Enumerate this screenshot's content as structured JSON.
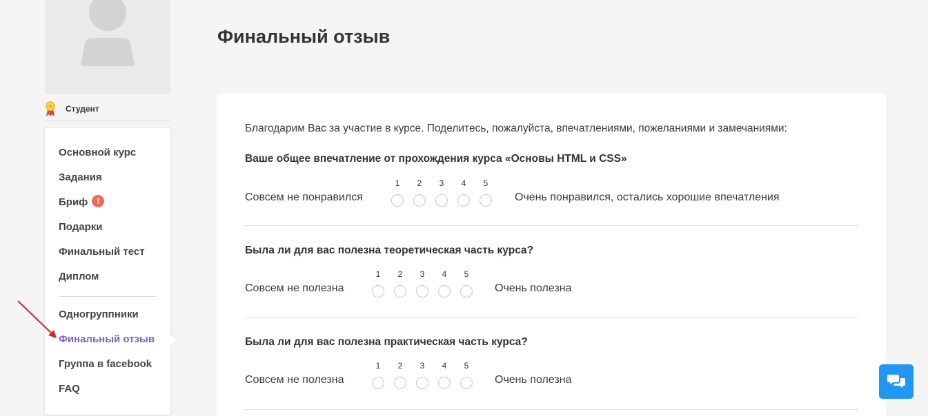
{
  "profile": {
    "role_label": "Студент"
  },
  "sidebar": {
    "items": [
      {
        "label": "Основной курс"
      },
      {
        "label": "Задания"
      },
      {
        "label": "Бриф",
        "badge": "!"
      },
      {
        "label": "Подарки"
      },
      {
        "label": "Финальный тест"
      },
      {
        "label": "Диплом"
      },
      {
        "label": "Одногруппники"
      },
      {
        "label": "Финальный отзыв",
        "active": true
      },
      {
        "label": "Группа в facebook"
      },
      {
        "label": "FAQ"
      }
    ]
  },
  "main": {
    "title": "Финальный отзыв",
    "intro": "Благодарим Вас за участие в курсе. Поделитесь, пожалуйста, впечатлениями, пожеланиями и замечаниями:",
    "scale_numbers": [
      "1",
      "2",
      "3",
      "4",
      "5"
    ],
    "questions": [
      {
        "title": "Ваше общее впечатление от прохождения курса «Основы HTML и CSS»",
        "low": "Совсем не понравился",
        "high": "Очень понравился, остались хорошие впечатления"
      },
      {
        "title": "Была ли для вас полезна теоретическая часть курса?",
        "low": "Совсем не полезна",
        "high": "Очень полезна"
      },
      {
        "title": "Была ли для вас полезна практическая часть курса?",
        "low": "Совсем не полезна",
        "high": "Очень полезна"
      }
    ]
  },
  "colors": {
    "accent": "#7b5fc7",
    "badge": "#f06b55",
    "chat": "#2196f3",
    "arrow": "#e02020"
  },
  "icons": {
    "avatar": "user-placeholder-icon",
    "medal": "medal-icon",
    "chat": "chat-bubbles-icon",
    "annotation": "red-arrow-icon"
  }
}
